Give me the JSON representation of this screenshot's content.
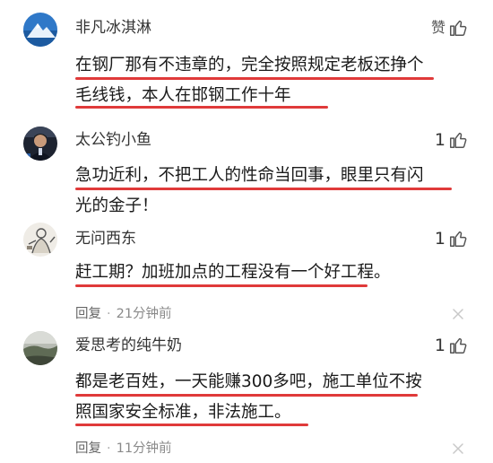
{
  "comments": [
    {
      "username": "非凡冰淇淋",
      "like_label": "赞",
      "text_line1": "在钢厂那有不违章的，完全按照规定老板还挣个",
      "text_line2": "毛线钱，本人在邯钢工作十年"
    },
    {
      "username": "太公钓小鱼",
      "like_count": "1",
      "text_line1": "急功近利，不把工人的性命当回事，眼里只有闪",
      "text_line2": "光的金子！"
    },
    {
      "username": "无问西东",
      "like_count": "1",
      "text_line1": "赶工期？加班加点的工程没有一个好工程。",
      "reply_label": "回复",
      "time": "21分钟前"
    },
    {
      "username": "爱思考的纯牛奶",
      "like_count": "1",
      "text_line1": "都是老百姓，一天能赚300多吧，施工单位不按",
      "text_line2": "照国家安全标准，非法施工。",
      "reply_label": "回复",
      "time": "11分钟前"
    }
  ],
  "colors": {
    "underline": "#e03a3a",
    "meta_text": "#8a8a8a"
  },
  "icons": {
    "like": "thumbs-up-icon",
    "dismiss": "close-icon"
  }
}
